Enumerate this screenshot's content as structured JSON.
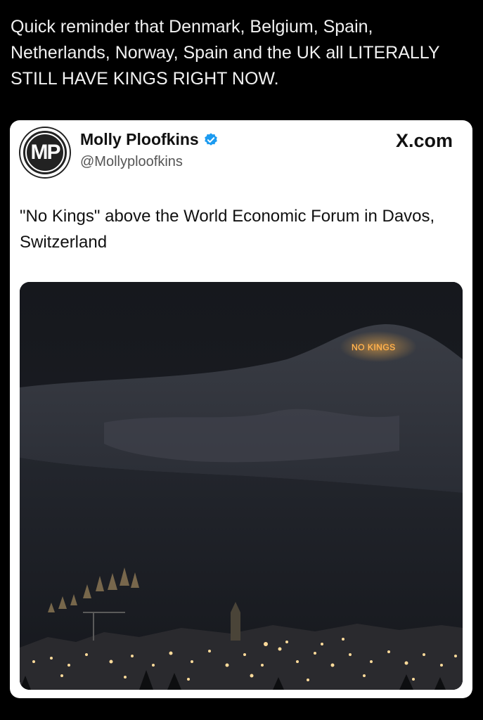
{
  "post": {
    "text": "Quick reminder that Denmark, Belgium, Spain, Netherlands, Norway, Spain and the UK all LITERALLY STILL HAVE KINGS RIGHT NOW."
  },
  "embed": {
    "avatar_initials": "MP",
    "author_name": "Molly Ploofkins",
    "handle": "@Mollyploofkins",
    "site": "X.com",
    "site_icon": "x-logo-icon",
    "verified_icon": "verified-badge-icon",
    "tweet_text": "\"No Kings\" above the World Economic Forum in Davos, Switzerland",
    "media": {
      "sign_text": "NO KINGS",
      "sign_color": "#ffb347",
      "description_icon": "night-mountain-photo"
    }
  }
}
